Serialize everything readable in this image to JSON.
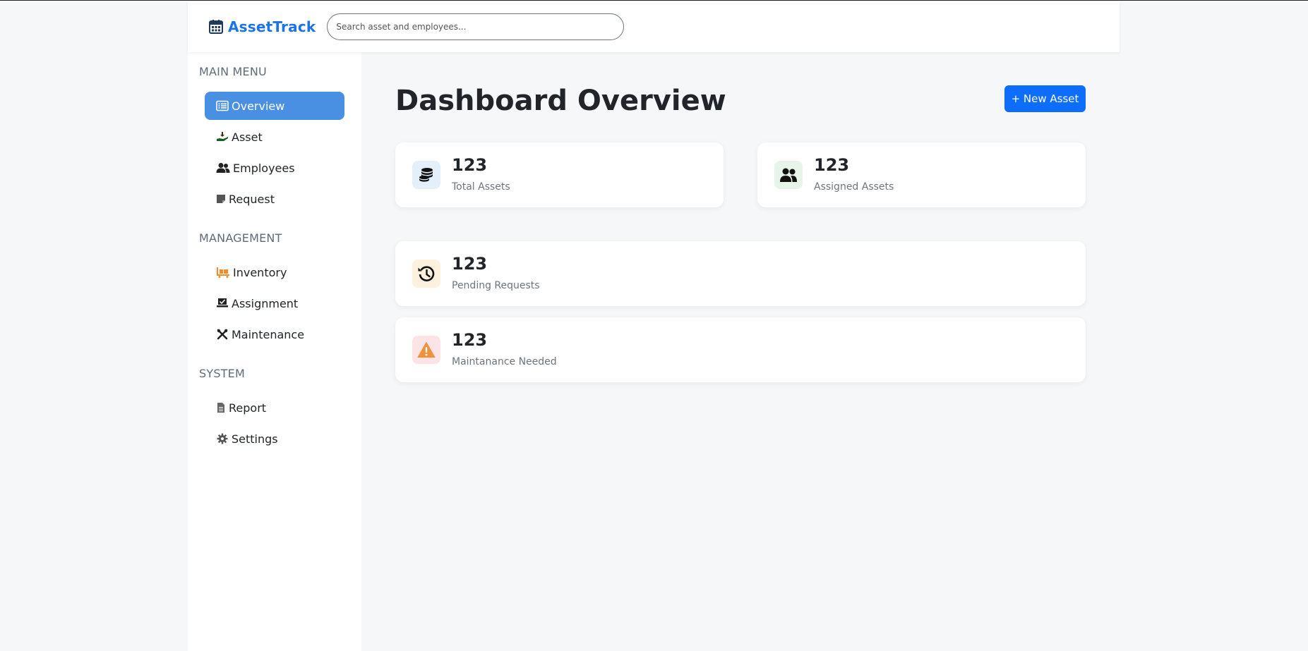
{
  "header": {
    "brand": "AssetTrack",
    "search_placeholder": "Search asset and employees..."
  },
  "sidebar": {
    "sections": [
      {
        "title": "MAIN MENU"
      },
      {
        "title": "MANAGEMENT"
      },
      {
        "title": "SYSTEM"
      }
    ],
    "items": [
      {
        "label": "Overview",
        "icon": "list-alt-icon",
        "active": true
      },
      {
        "label": "Asset",
        "icon": "hand-holding-dollar-icon"
      },
      {
        "label": "Employees",
        "icon": "users-icon"
      },
      {
        "label": "Request",
        "icon": "note-icon"
      },
      {
        "label": "Inventory",
        "icon": "dolly-icon"
      },
      {
        "label": "Assignment",
        "icon": "laptop-check-icon"
      },
      {
        "label": "Maintenance",
        "icon": "tools-icon"
      },
      {
        "label": "Report",
        "icon": "file-icon"
      },
      {
        "label": "Settings",
        "icon": "gear-icon"
      }
    ]
  },
  "main": {
    "title": "Dashboard Overview",
    "new_button": "+ New Asset",
    "cards": [
      {
        "value": "123",
        "label": "Total Assets",
        "icon": "coins-icon",
        "color": "#e3f0fc"
      },
      {
        "value": "123",
        "label": "Assigned Assets",
        "icon": "users-icon",
        "color": "#e6f4ea"
      },
      {
        "value": "123",
        "label": "Pending Requests",
        "icon": "history-icon",
        "color": "#fdf1de"
      },
      {
        "value": "123",
        "label": "Maintanance Needed",
        "icon": "warning-icon",
        "color": "#fbe3e6"
      }
    ]
  },
  "colors": {
    "accent": "#1a73e8",
    "active_nav": "#4a90e2",
    "primary_button": "#0d6efd"
  }
}
